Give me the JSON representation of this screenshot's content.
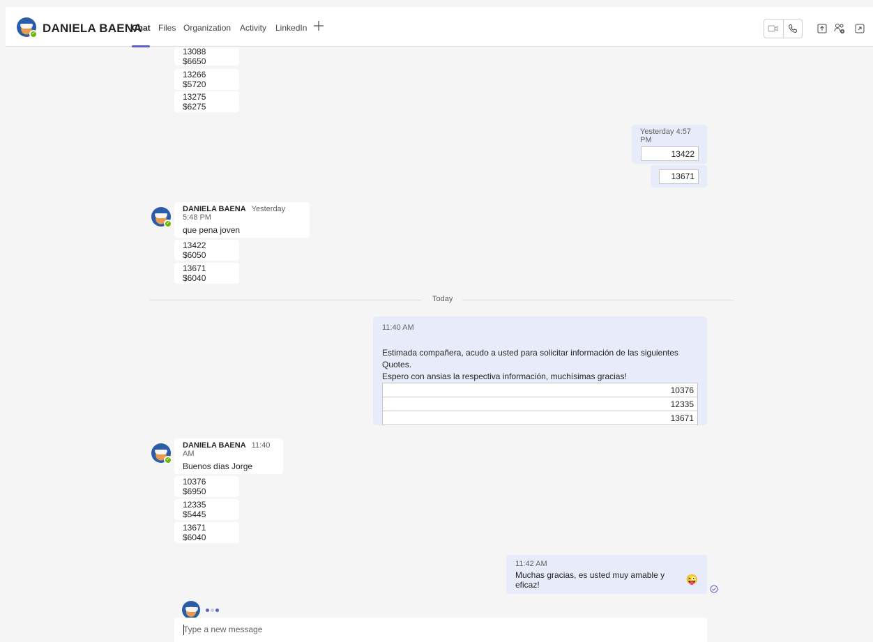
{
  "header": {
    "name": "DANIELA BAENA",
    "tabs": [
      {
        "label": "Chat"
      },
      {
        "label": "Files"
      },
      {
        "label": "Organization"
      },
      {
        "label": "Activity"
      },
      {
        "label": "LinkedIn"
      }
    ],
    "add_tab_icon": "plus-icon",
    "icons": [
      "video-call-icon",
      "audio-call-icon",
      "share-screen-icon",
      "add-people-icon",
      "pop-out-icon"
    ]
  },
  "earlier_items": [
    {
      "text": "13088 $6650"
    },
    {
      "text": "13266 $5720"
    },
    {
      "text": "13275 $6275"
    }
  ],
  "my_message_1": {
    "timestamp": "Yesterday 4:57 PM",
    "quote": "13422",
    "quote2": "13671"
  },
  "daniela_message_1": {
    "sender": "DANIELA BAENA",
    "timestamp": "Yesterday 5:48 PM",
    "text": "que pena joven",
    "items": [
      {
        "text": "13422 $6050"
      },
      {
        "text": "13671 $6040"
      }
    ]
  },
  "divider": {
    "label": "Today"
  },
  "my_message_2": {
    "timestamp": "11:40 AM",
    "line1": "Estimada compañera, acudo a usted para solicitar información de las siguientes Quotes.",
    "line2": "Espero con ansias la respectiva información, muchísimas gracias!",
    "quotes": [
      "10376",
      "12335",
      "13671"
    ]
  },
  "daniela_message_2": {
    "sender": "DANIELA BAENA",
    "timestamp": "11:40 AM",
    "text": "Buenos días Jorge",
    "items": [
      {
        "text": "10376 $6950"
      },
      {
        "text": "12335 $5445"
      },
      {
        "text": "13671 $6040"
      }
    ]
  },
  "my_message_3": {
    "timestamp": "11:42 AM",
    "text": "Muchas gracias, es usted muy amable y eficaz!",
    "emoji": "😜"
  },
  "composer": {
    "placeholder": "Type a new message"
  },
  "colors": {
    "accent": "#5b5fc7",
    "my_bubble": "#e8ebfa",
    "other_bubble": "#ffffff",
    "presence": "#6bb700",
    "background": "#f5f5f5"
  }
}
